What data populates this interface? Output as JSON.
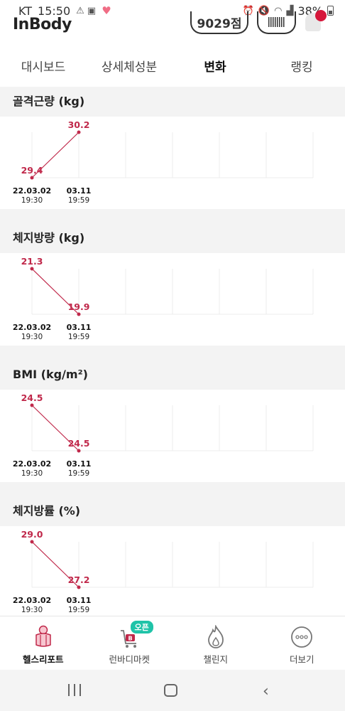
{
  "status_bar": {
    "carrier": "KT",
    "time": "15:50",
    "battery": "38%"
  },
  "header": {
    "logo": "InBody",
    "points": "9029점"
  },
  "tabs": [
    "대시보드",
    "상세체성분",
    "변화",
    "랭킹"
  ],
  "active_tab": "변화",
  "sections": [
    {
      "title": "골격근량 (kg)",
      "chart_data": {
        "type": "line",
        "x": [
          "22.03.02 19:30",
          "03.11 19:59"
        ],
        "values": [
          29.4,
          30.2
        ]
      }
    },
    {
      "title": "체지방량 (kg)",
      "chart_data": {
        "type": "line",
        "x": [
          "22.03.02 19:30",
          "03.11 19:59"
        ],
        "values": [
          21.3,
          19.9
        ]
      }
    },
    {
      "title": "BMI (kg/m²)",
      "chart_data": {
        "type": "line",
        "x": [
          "22.03.02 19:30",
          "03.11 19:59"
        ],
        "values": [
          24.5,
          24.5
        ]
      }
    },
    {
      "title": "체지방률 (%)",
      "chart_data": {
        "type": "line",
        "x": [
          "22.03.02 19:30",
          "03.11 19:59"
        ],
        "values": [
          29.0,
          27.2
        ]
      }
    }
  ],
  "x_labels": {
    "first_date": "22.03.02",
    "first_time": "19:30",
    "second_date": "03.11",
    "second_time": "19:59"
  },
  "bottom_nav": [
    {
      "label": "헬스리포트",
      "icon": "health-report-icon"
    },
    {
      "label": "런바디마켓",
      "icon": "market-bag-icon",
      "badge": "오픈"
    },
    {
      "label": "챌린지",
      "icon": "flame-icon"
    },
    {
      "label": "더보기",
      "icon": "more-dots-icon"
    }
  ],
  "colors": {
    "accent": "#c0284a",
    "open_badge": "#1fc3a8"
  }
}
